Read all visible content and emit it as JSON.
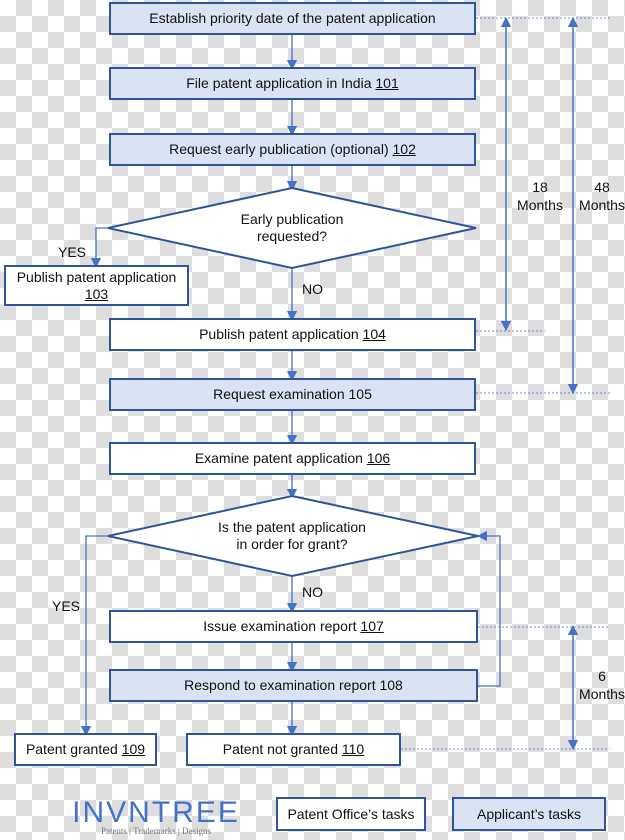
{
  "colors": {
    "applicant_fill": "#dae3f3",
    "border": "#2f5597",
    "connector": "#4472c4"
  },
  "steps": {
    "s0": {
      "text": "Establish priority date of the patent application",
      "num": ""
    },
    "s101": {
      "text": "File patent application in India ",
      "num": "101"
    },
    "s102": {
      "text": "Request early publication (optional) ",
      "num": "102"
    },
    "d1": {
      "line1": "Early publication",
      "line2": "requested?"
    },
    "s103": {
      "text": "Publish patent application",
      "num": "103"
    },
    "s104": {
      "text": "Publish patent application ",
      "num": "104"
    },
    "s105": {
      "text": "Request examination 105"
    },
    "s106": {
      "text": "Examine patent application ",
      "num": "106"
    },
    "d2": {
      "line1": "Is the patent application",
      "line2": "in order for grant?"
    },
    "s107": {
      "text": "Issue examination report ",
      "num": "107"
    },
    "s108": {
      "text": "Respond to examination report 108"
    },
    "s109": {
      "text": "Patent granted ",
      "num": "109"
    },
    "s110": {
      "text": "Patent not granted ",
      "num": "110"
    }
  },
  "labels": {
    "yes1": "YES",
    "no1": "NO",
    "yes2": "YES",
    "no2": "NO"
  },
  "durations": {
    "m18": {
      "value": "18",
      "unit": "Months"
    },
    "m48": {
      "value": "48",
      "unit": "Months"
    },
    "m6": {
      "value": "6",
      "unit": "Months"
    }
  },
  "legend": {
    "office": "Patent Office’s tasks",
    "applicant": "Applicant’s tasks"
  },
  "logo": {
    "name": "INVNTREE",
    "tagline": "Patents | Trademarks | Designs"
  }
}
